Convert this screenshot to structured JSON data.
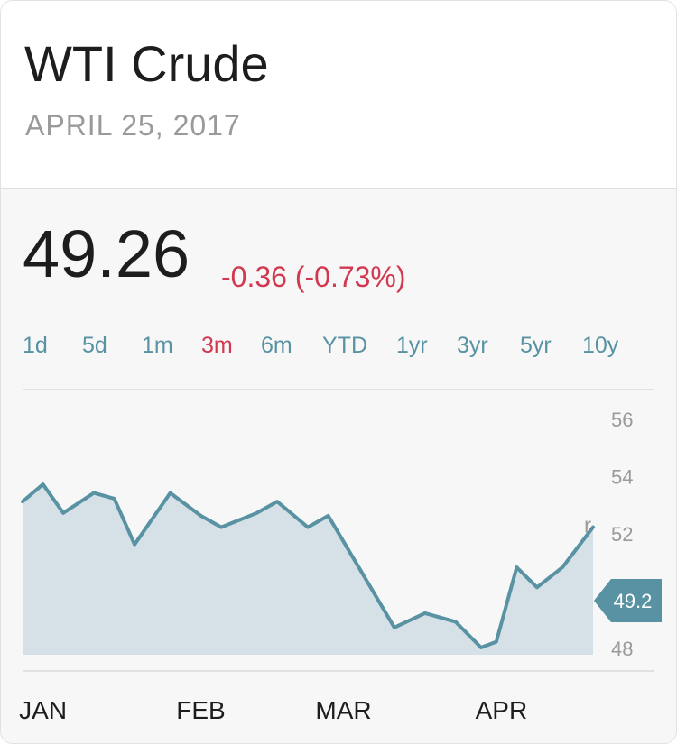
{
  "header": {
    "title": "WTI Crude",
    "date": "APRIL 25, 2017"
  },
  "quote": {
    "price": "49.26",
    "change": "-0.36 (-0.73%)"
  },
  "ranges": [
    {
      "label": "1d",
      "active": false
    },
    {
      "label": "5d",
      "active": false
    },
    {
      "label": "1m",
      "active": false
    },
    {
      "label": "3m",
      "active": true
    },
    {
      "label": "6m",
      "active": false
    },
    {
      "label": "YTD",
      "active": false
    },
    {
      "label": "1yr",
      "active": false
    },
    {
      "label": "3yr",
      "active": false
    },
    {
      "label": "5yr",
      "active": false
    },
    {
      "label": "10y",
      "active": false
    }
  ],
  "colors": {
    "line": "#5892a3",
    "area": "#d5e1e7",
    "negative": "#d2384f",
    "axis_text": "#9a9a9a"
  },
  "chart_data": {
    "type": "area",
    "x": [
      "2017-01-23",
      "2017-01-27",
      "2017-01-31",
      "2017-02-06",
      "2017-02-10",
      "2017-02-14",
      "2017-02-21",
      "2017-02-27",
      "2017-03-03",
      "2017-03-10",
      "2017-03-14",
      "2017-03-20",
      "2017-03-24",
      "2017-03-31",
      "2017-04-06",
      "2017-04-12",
      "2017-04-18",
      "2017-04-23",
      "2017-04-26",
      "2017-04-30",
      "2017-05-04",
      "2017-05-09",
      "2017-05-15"
    ],
    "y": [
      53.1,
      53.7,
      52.7,
      53.4,
      53.2,
      51.6,
      53.4,
      52.6,
      52.2,
      52.7,
      53.1,
      52.2,
      52.6,
      50.5,
      48.7,
      49.2,
      48.9,
      48.0,
      48.2,
      50.8,
      50.1,
      50.8,
      52.2
    ],
    "ylim": [
      47.5,
      56.5
    ],
    "yticks": [
      "56",
      "54",
      "52",
      "50",
      "48"
    ],
    "ytick_values": [
      56,
      54,
      52,
      50,
      48
    ],
    "xticks": [
      "JAN",
      "FEB",
      "MAR",
      "APR"
    ],
    "xtick_values": [
      "2017-01-27",
      "2017-02-27",
      "2017-03-27",
      "2017-04-27"
    ],
    "current_label": "49.2",
    "current_value": 49.2,
    "marker_glyph": "r",
    "grid": false
  }
}
